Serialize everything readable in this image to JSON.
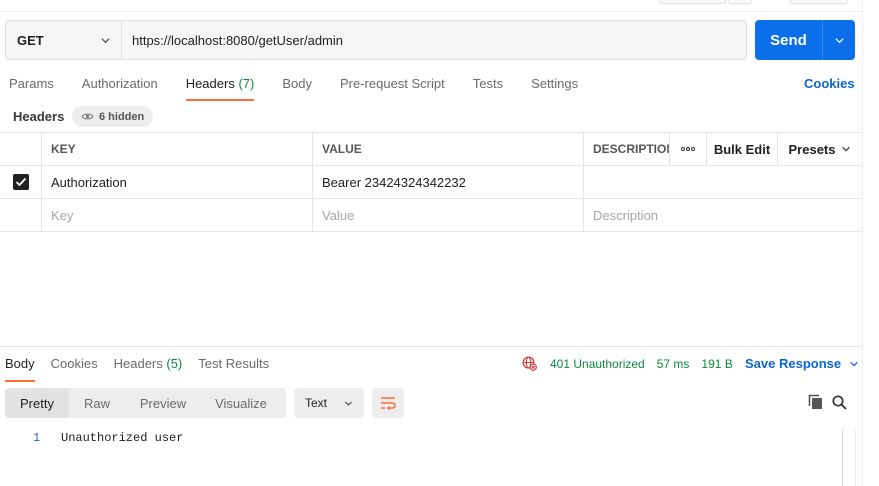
{
  "request": {
    "method": "GET",
    "url": "https://localhost:8080/getUser/admin",
    "send_label": "Send"
  },
  "tabs": [
    {
      "label": "Params"
    },
    {
      "label": "Authorization"
    },
    {
      "label": "Headers",
      "count": "(7)"
    },
    {
      "label": "Body"
    },
    {
      "label": "Pre-request Script"
    },
    {
      "label": "Tests"
    },
    {
      "label": "Settings"
    }
  ],
  "cookies_label": "Cookies",
  "headers_section": {
    "title": "Headers",
    "hidden_label": "6 hidden"
  },
  "table": {
    "columns": {
      "key": "KEY",
      "value": "VALUE",
      "description": "DESCRIPTION"
    },
    "tools": {
      "bulk_edit": "Bulk Edit",
      "presets": "Presets"
    },
    "rows": [
      {
        "checked": true,
        "key": "Authorization",
        "value": "Bearer 23424324342232",
        "description": ""
      }
    ],
    "placeholders": {
      "key": "Key",
      "value": "Value",
      "description": "Description"
    }
  },
  "response": {
    "tabs": [
      {
        "label": "Body"
      },
      {
        "label": "Cookies"
      },
      {
        "label": "Headers",
        "count": "(5)"
      },
      {
        "label": "Test Results"
      }
    ],
    "status": "401 Unauthorized",
    "time": "57 ms",
    "size": "191 B",
    "save_label": "Save Response",
    "views": [
      "Pretty",
      "Raw",
      "Preview",
      "Visualize"
    ],
    "format": "Text",
    "body_lines": [
      {
        "no": "1",
        "text": "Unauthorized user"
      }
    ]
  },
  "colors": {
    "accent_orange": "#ff6c37",
    "send_blue": "#0a6fe8",
    "link_blue": "#0b65d8",
    "status_green": "#0d8a3c",
    "error_red": "#d63a3a"
  },
  "icons": [
    "chevron-down-icon",
    "eye-icon",
    "more-dots-icon",
    "checkbox-checked-icon",
    "globe-error-icon",
    "wrap-lines-icon",
    "copy-icon",
    "search-icon"
  ]
}
